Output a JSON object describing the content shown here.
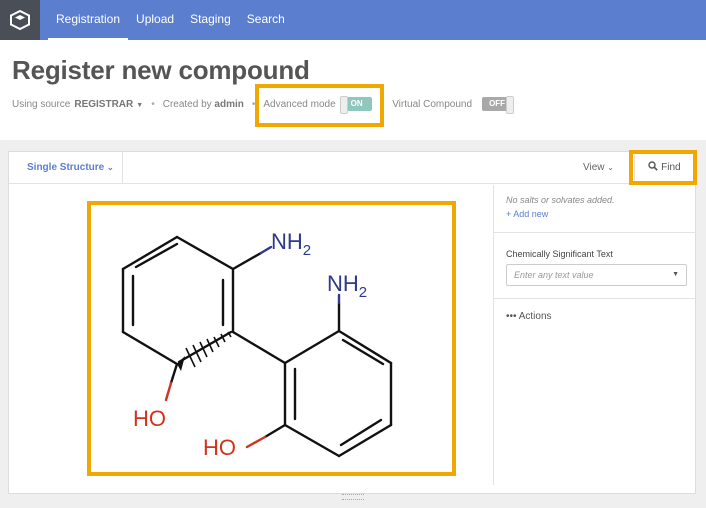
{
  "nav": {
    "logo_icon": "app-logo-icon",
    "items": [
      {
        "label": "Registration",
        "active": true
      },
      {
        "label": "Upload",
        "active": false
      },
      {
        "label": "Staging",
        "active": false
      },
      {
        "label": "Search",
        "active": false
      }
    ]
  },
  "header": {
    "title": "Register new compound",
    "source_prefix": "Using source",
    "source_value": "REGISTRAR",
    "created_prefix": "Created by",
    "created_by": "admin",
    "advanced_mode_label": "Advanced mode",
    "advanced_mode_state": "ON",
    "virtual_compound_label": "Virtual Compound",
    "virtual_compound_state": "OFF"
  },
  "panel": {
    "structure_tab_label": "Single Structure",
    "view_label": "View",
    "find_label": "Find"
  },
  "sidebar": {
    "salts_note": "No salts or solvates added.",
    "add_new_label": "+ Add new",
    "cst_label": "Chemically Significant Text",
    "cst_placeholder": "Enter any text value",
    "actions_label": "••• Actions"
  },
  "molecule": {
    "labels": {
      "nh2_top": "NH",
      "nh2_right": "NH",
      "sub": "2",
      "oh_left": "HO",
      "oh_bottom": "HO"
    }
  },
  "colors": {
    "nav_bg": "#5b7fce",
    "highlight": "#f0a800",
    "nitrogen": "#2e3a8c",
    "oxygen": "#d2321e",
    "toggle_on": "#8fc7be",
    "toggle_off": "#a9a9a9"
  }
}
